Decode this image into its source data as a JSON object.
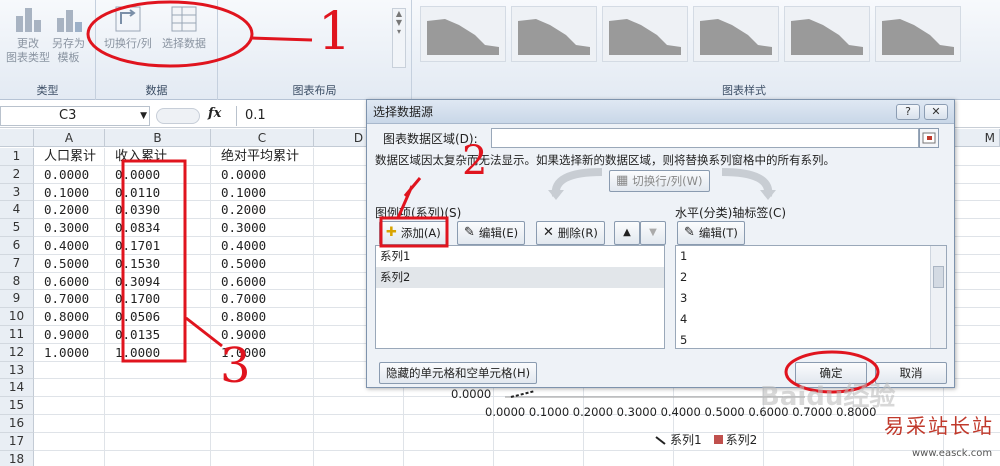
{
  "ribbon": {
    "groups": [
      {
        "label": "类型",
        "buttons": [
          {
            "label": "更改\n图表类型"
          },
          {
            "label": "另存为\n模板"
          }
        ]
      },
      {
        "label": "数据",
        "buttons": [
          {
            "label": "切换行/列"
          },
          {
            "label": "选择数据"
          }
        ]
      },
      {
        "label": "图表布局"
      },
      {
        "label": "图表样式"
      }
    ]
  },
  "formula_bar": {
    "name_box": "C3",
    "fx": "fx",
    "value": "0.1"
  },
  "sheet": {
    "columns": [
      "A",
      "B",
      "C",
      "D"
    ],
    "far_column": "M",
    "rows": [
      "1",
      "2",
      "3",
      "4",
      "5",
      "6",
      "7",
      "8",
      "9",
      "10",
      "11",
      "12",
      "13",
      "14",
      "15",
      "16",
      "17",
      "18"
    ],
    "headers": [
      "人口累计",
      "收入累计",
      "绝对平均累计"
    ],
    "data": [
      [
        "0.0000",
        "0.0000",
        "0.0000"
      ],
      [
        "0.1000",
        "0.0110",
        "0.1000"
      ],
      [
        "0.2000",
        "0.0390",
        "0.2000"
      ],
      [
        "0.3000",
        "0.0834",
        "0.3000"
      ],
      [
        "0.4000",
        "0.1701",
        "0.4000"
      ],
      [
        "0.5000",
        "0.1530",
        "0.5000"
      ],
      [
        "0.6000",
        "0.3094",
        "0.6000"
      ],
      [
        "0.7000",
        "0.1700",
        "0.7000"
      ],
      [
        "0.8000",
        "0.0506",
        "0.8000"
      ],
      [
        "0.9000",
        "0.0135",
        "0.9000"
      ],
      [
        "1.0000",
        "1.0000",
        "1.0000"
      ]
    ]
  },
  "chart": {
    "y_tick": "0.0000",
    "x_ticks": "0.0000 0.1000 0.2000 0.3000 0.4000 0.5000 0.6000 0.7000 0.8000",
    "legend": [
      {
        "name": "系列1",
        "color": "#222222"
      },
      {
        "name": "系列2",
        "color": "#c0504d"
      }
    ]
  },
  "dialog": {
    "title": "选择数据源",
    "help_btn": "?",
    "close_btn": "✕",
    "range_label": "图表数据区域(D):",
    "range_value": "",
    "info_text": "数据区域因太复杂而无法显示。如果选择新的数据区域，则将替换系列窗格中的所有系列。",
    "switch_btn": "切换行/列(W)",
    "series_label": "图例项(系列)(S)",
    "add_btn": "添加(A)",
    "edit_btn": "编辑(E)",
    "delete_btn": "删除(R)",
    "series": [
      "系列1",
      "系列2"
    ],
    "axis_label": "水平(分类)轴标签(C)",
    "axis_edit_btn": "编辑(T)",
    "axis_items": [
      "1",
      "2",
      "3",
      "4",
      "5"
    ],
    "hidden_btn": "隐藏的单元格和空单元格(H)",
    "ok_btn": "确定",
    "cancel_btn": "取消"
  },
  "annotations": {
    "n1": "1",
    "n2": "2",
    "n3": "3"
  },
  "watermark": {
    "logo": "Baidu经验",
    "site": "易采站长站",
    "url": "www.easck.com"
  }
}
